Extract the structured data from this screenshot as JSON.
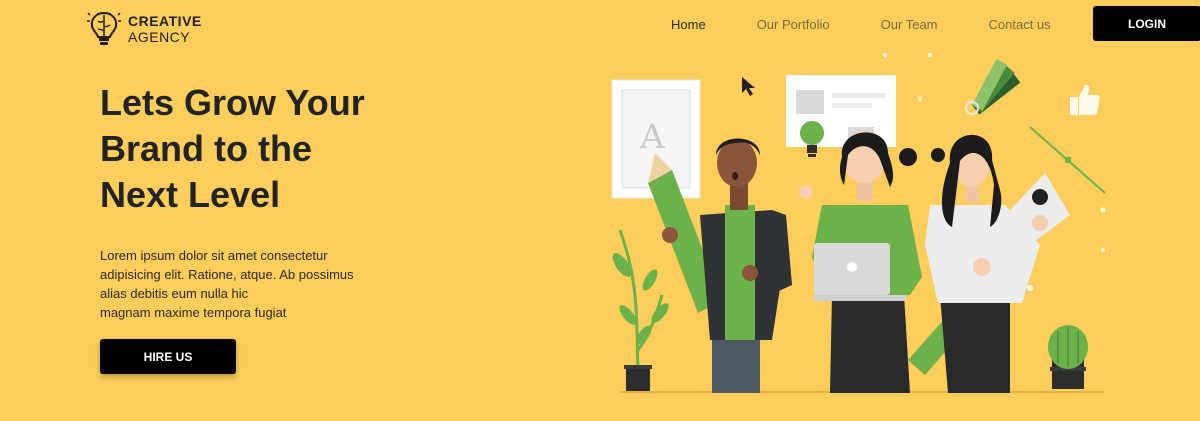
{
  "brand": {
    "line1": "CREATIVE",
    "line2": "AGENCY"
  },
  "nav": {
    "items": [
      {
        "label": "Home",
        "active": true
      },
      {
        "label": "Our Portfolio",
        "active": false
      },
      {
        "label": "Our Team",
        "active": false
      },
      {
        "label": "Contact us",
        "active": false
      }
    ],
    "login_label": "LOGIN"
  },
  "hero": {
    "headline_lines": [
      "Lets Grow Your",
      "Brand to the",
      "Next Level"
    ],
    "lead_lines": [
      "Lorem ipsum dolor sit amet consectetur",
      "adipisicing elit. Ratione, atque. Ab possimus",
      "alias debitis eum nulla hic",
      "magnam maxime tempora fugiat"
    ],
    "cta_label": "HIRE US",
    "illustration_letter": "A"
  },
  "colors": {
    "background": "#fbcd5a",
    "accent_green": "#6cb14a",
    "dark": "#000000"
  }
}
